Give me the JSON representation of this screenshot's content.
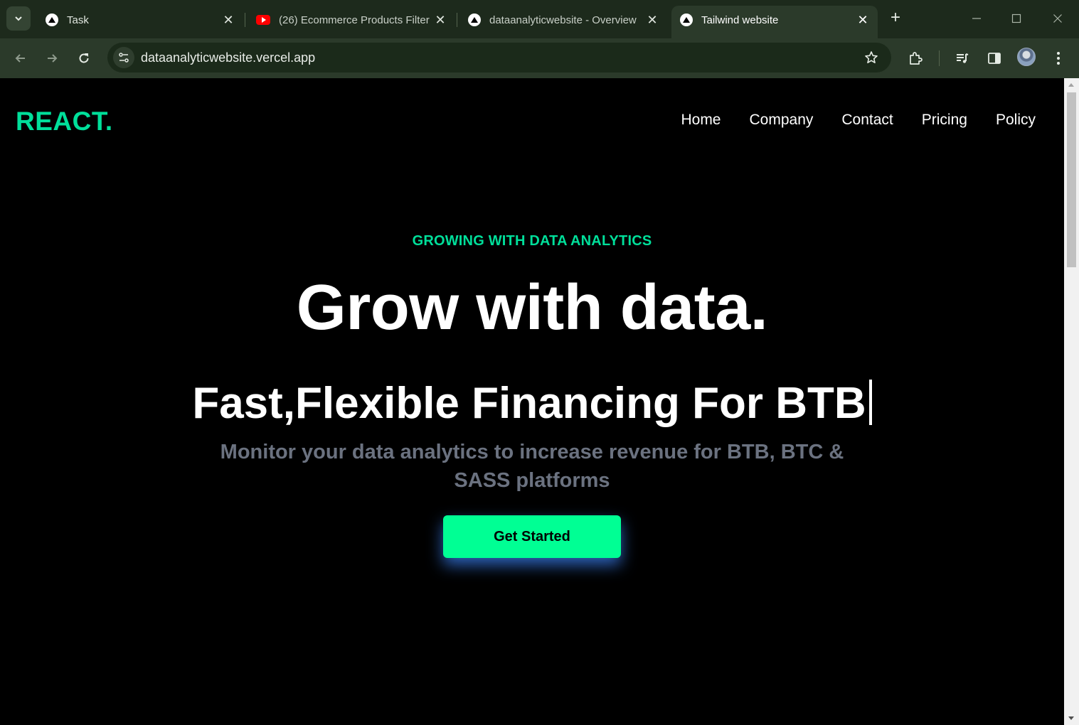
{
  "browser": {
    "tabs": [
      {
        "title": "Task",
        "favicon": "vercel-triangle-icon",
        "active": false
      },
      {
        "title": "(26) Ecommerce Products Filter",
        "favicon": "youtube-icon",
        "active": false
      },
      {
        "title": "dataanalyticwebsite - Overview",
        "favicon": "vercel-triangle-icon",
        "active": false
      },
      {
        "title": "Tailwind website",
        "favicon": "vercel-triangle-icon",
        "active": true
      }
    ],
    "url": "dataanalyticwebsite.vercel.app"
  },
  "site": {
    "logo": "REACT.",
    "nav": [
      "Home",
      "Company",
      "Contact",
      "Pricing",
      "Policy"
    ],
    "hero": {
      "eyebrow": "GROWING WITH DATA ANALYTICS",
      "title": "Grow with data.",
      "typed_text": "Fast,Flexible Financing For BTB",
      "subtitle": "Monitor your data analytics to increase revenue for BTB, BTC & SASS platforms",
      "cta_label": "Get Started"
    },
    "colors": {
      "accent": "#00df9a",
      "cta_background": "#00ff94",
      "cta_glow": "#3b82f6",
      "subtitle": "#6b7280",
      "background": "#000000"
    }
  }
}
